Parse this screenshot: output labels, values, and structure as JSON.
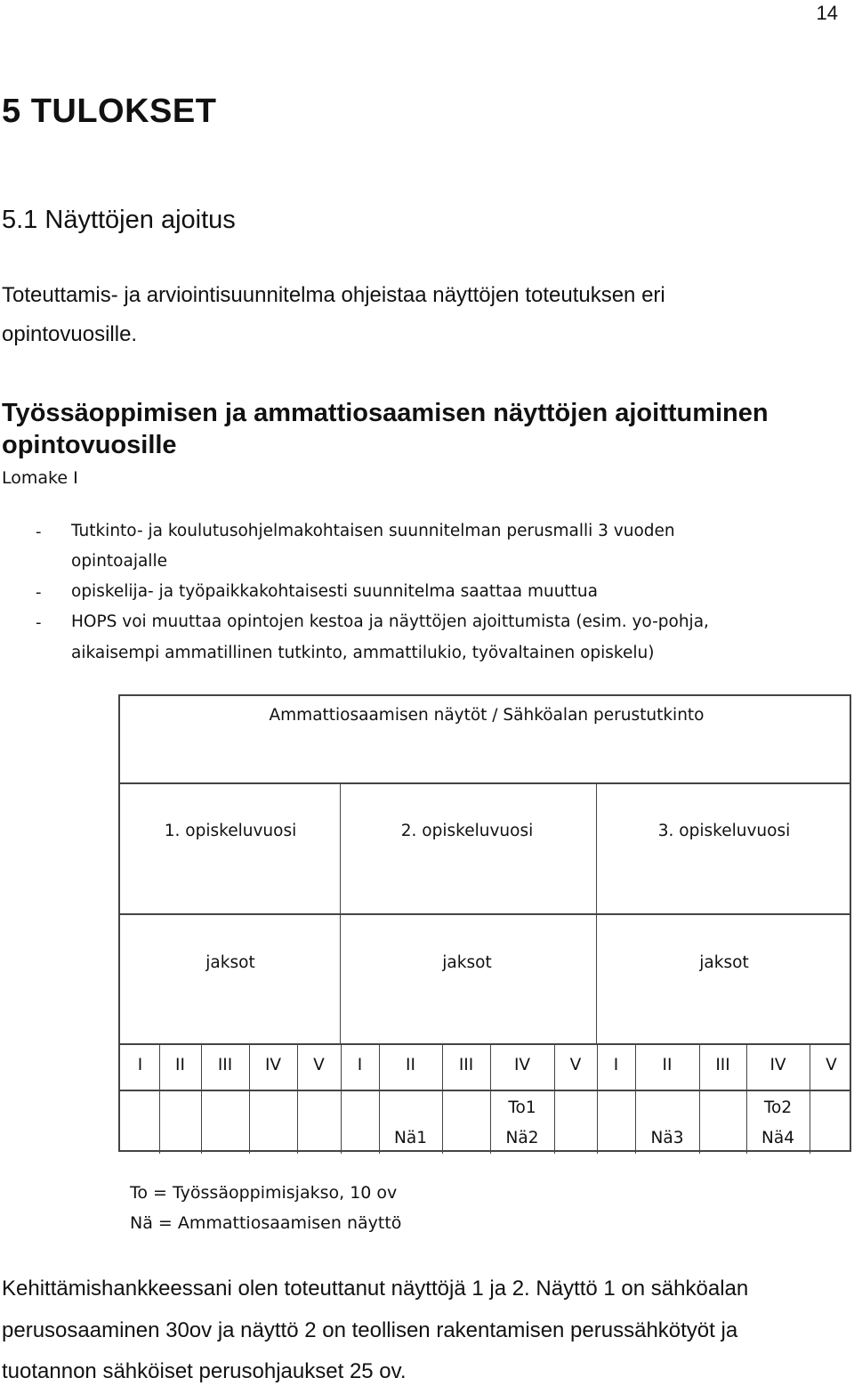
{
  "page_number": "14",
  "chapter_heading": "5  TULOKSET",
  "section_heading": "5.1  Näyttöjen ajoitus",
  "intro_paragraph": {
    "line1": "Toteuttamis- ja arviointisuunnitelma ohjeistaa näyttöjen toteutuksen eri",
    "line2": "opintovuosille."
  },
  "form": {
    "title": "Työssäoppimisen ja ammattiosaamisen näyttöjen ajoittuminen opintovuosille",
    "label": "Lomake I",
    "bullets": [
      {
        "dash": "-",
        "lines": [
          "Tutkinto- ja koulutusohjelmakohtaisen suunnitelman perusmalli 3 vuoden",
          "opintoajalle"
        ]
      },
      {
        "dash": "-",
        "lines": [
          "opiskelija- ja työpaikkakohtaisesti suunnitelma saattaa muuttua"
        ]
      },
      {
        "dash": "-",
        "lines": [
          "HOPS voi muuttaa opintojen kestoa ja näyttöjen ajoittumista (esim. yo-pohja,",
          "aikaisempi ammatillinen tutkinto, ammattilukio, työvaltainen opiskelu)"
        ]
      }
    ]
  },
  "table": {
    "title": "Ammattiosaamisen näytöt  / Sähköalan perustutkinto",
    "years": [
      "1. opiskeluvuosi",
      "2. opiskeluvuosi",
      "3. opiskeluvuosi"
    ],
    "period_label": [
      "jaksot",
      "jaksot",
      "jaksot"
    ],
    "periods": [
      "I",
      "II",
      "III",
      "IV",
      "V",
      "I",
      "II",
      "III",
      "IV",
      "V",
      "I",
      "II",
      "III",
      "IV",
      "V"
    ],
    "markers": [
      {
        "top": "",
        "bottom": ""
      },
      {
        "top": "",
        "bottom": ""
      },
      {
        "top": "",
        "bottom": ""
      },
      {
        "top": "",
        "bottom": ""
      },
      {
        "top": "",
        "bottom": ""
      },
      {
        "top": "",
        "bottom": ""
      },
      {
        "top": "",
        "bottom": "Nä1"
      },
      {
        "top": "",
        "bottom": ""
      },
      {
        "top": "To1",
        "bottom": "Nä2"
      },
      {
        "top": "",
        "bottom": ""
      },
      {
        "top": "",
        "bottom": ""
      },
      {
        "top": "",
        "bottom": "Nä3"
      },
      {
        "top": "",
        "bottom": ""
      },
      {
        "top": "To2",
        "bottom": "Nä4"
      },
      {
        "top": "",
        "bottom": ""
      }
    ]
  },
  "legend": {
    "to": "To = Työssäoppimisjakso, 10 ov",
    "na": "Nä = Ammattiosaamisen näyttö"
  },
  "closing_paragraph": {
    "line1": "Kehittämishankkeessani olen toteuttanut näyttöjä 1 ja 2. Näyttö 1 on sähköalan",
    "line2": "perusosaaminen 30ov ja näyttö 2 on teollisen rakentamisen perussähkötyöt ja",
    "line3": "tuotannon sähköiset perusohjaukset 25 ov."
  }
}
